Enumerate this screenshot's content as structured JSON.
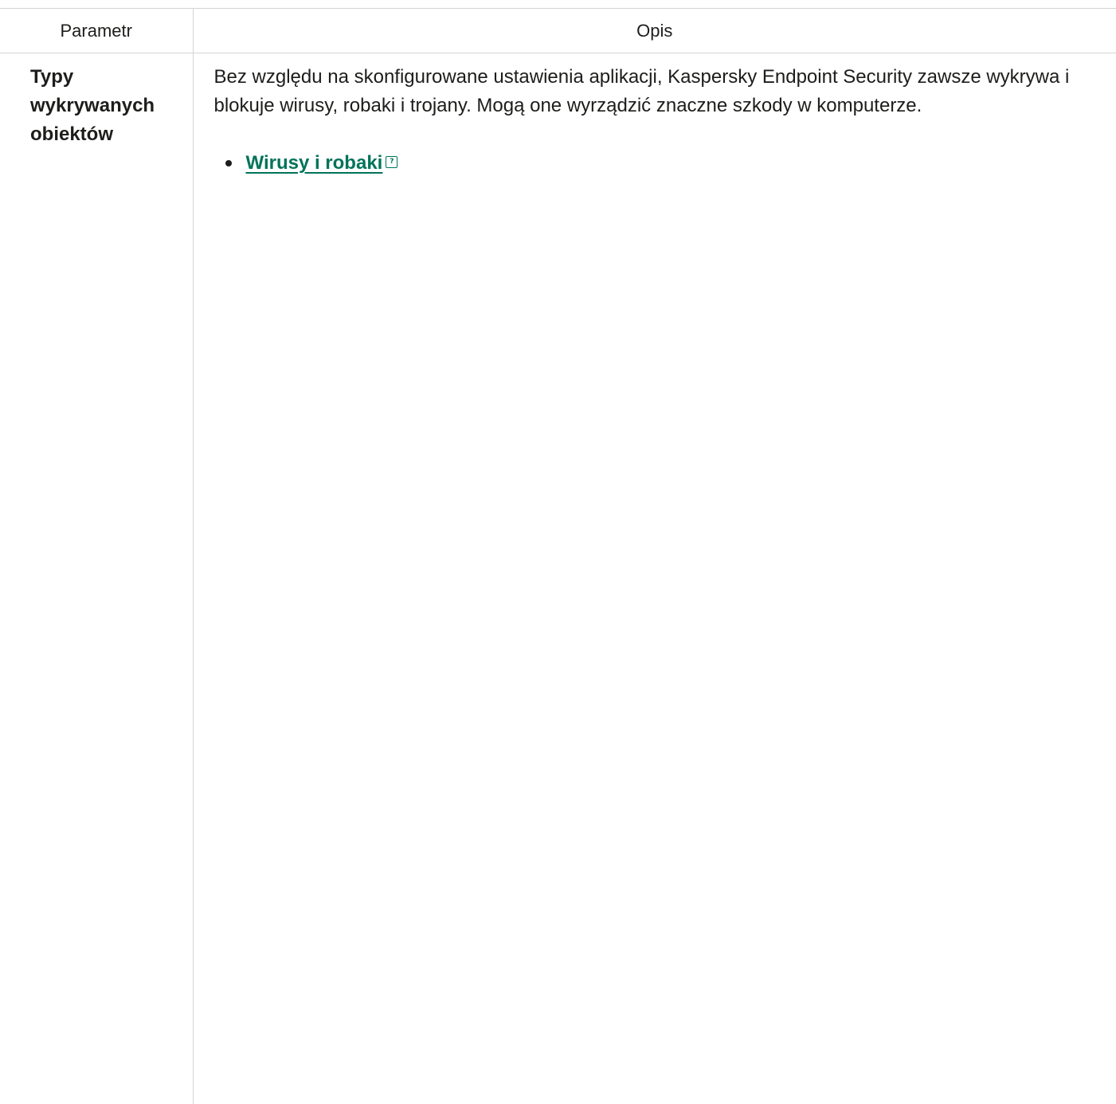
{
  "table": {
    "header": {
      "param": "Parametr",
      "desc": "Opis"
    },
    "rows": [
      {
        "param": "Typy wykrywanych obiektów",
        "description": "Bez względu na skonfigurowane ustawienia aplikacji, Kaspersky Endpoint Security zawsze wykrywa i blokuje wirusy, robaki i trojany. Mogą one wyrządzić znaczne szkody w komputerze.",
        "links": [
          {
            "label": "Wirusy i robaki",
            "icon": "help-expand-icon"
          }
        ]
      }
    ]
  },
  "colors": {
    "link": "#00735a",
    "border": "#d4d4d4",
    "text": "#1d1d1b"
  }
}
